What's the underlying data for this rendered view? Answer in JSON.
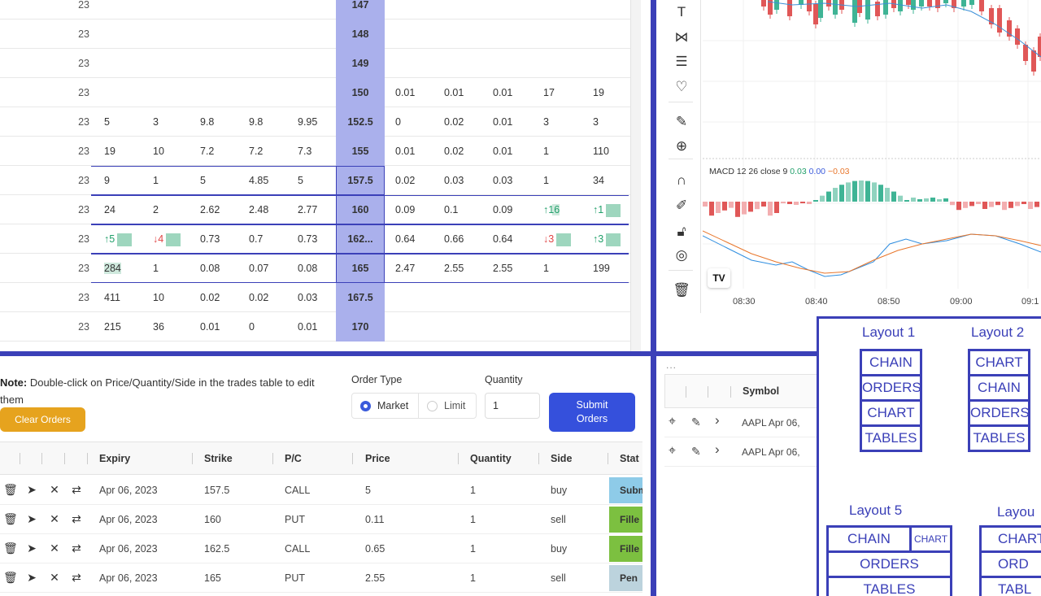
{
  "chain": {
    "rows": [
      {
        "exp": "23",
        "strike": "147",
        "cells": []
      },
      {
        "exp": "23",
        "strike": "148",
        "cells": []
      },
      {
        "exp": "23",
        "strike": "149",
        "cells": []
      },
      {
        "exp": "23",
        "strike": "150",
        "cells": [
          "",
          "",
          "",
          "",
          "",
          "0.01",
          "0.01",
          "0.01",
          "17",
          "19"
        ]
      },
      {
        "exp": "23",
        "strike": "152.5",
        "cells": [
          "5",
          "3",
          "9.8",
          "9.8",
          "9.95",
          "0",
          "0.02",
          "0.01",
          "3",
          "3"
        ]
      },
      {
        "exp": "23",
        "strike": "155",
        "cells": [
          "19",
          "10",
          "7.2",
          "7.2",
          "7.3",
          "0.01",
          "0.02",
          "0.01",
          "1",
          "110"
        ]
      },
      {
        "exp": "23",
        "strike": "157.5",
        "cells": [
          "9",
          "1",
          "5",
          "4.85",
          "5",
          "0.02",
          "0.03",
          "0.03",
          "1",
          "34"
        ]
      },
      {
        "exp": "23",
        "strike": "160",
        "cells": [
          "24",
          "2",
          "2.62",
          "2.48",
          "2.77",
          "0.09",
          "0.1",
          "0.09",
          "↑16",
          "↑1"
        ]
      },
      {
        "exp": "23",
        "strike": "162...",
        "cells": [
          "↑5",
          "↓4",
          "0.73",
          "0.7",
          "0.73",
          "0.64",
          "0.66",
          "0.64",
          "↓3",
          "↑3"
        ]
      },
      {
        "exp": "23",
        "strike": "165",
        "cells": [
          "284",
          "1",
          "0.08",
          "0.07",
          "0.08",
          "2.47",
          "2.55",
          "2.55",
          "1",
          "199"
        ]
      },
      {
        "exp": "23",
        "strike": "167.5",
        "cells": [
          "411",
          "10",
          "0.02",
          "0.02",
          "0.03",
          "",
          "",
          "",
          "",
          ""
        ]
      },
      {
        "exp": "23",
        "strike": "170",
        "cells": [
          "215",
          "36",
          "0.01",
          "0",
          "0.01",
          "",
          "",
          "",
          "",
          ""
        ]
      }
    ]
  },
  "chart": {
    "macd_label": "MACD 12 26 close 9",
    "macd_values": [
      "0.03",
      "0.00",
      "−0.03"
    ],
    "macd_colors": [
      "#22a06b",
      "#3b5bdb",
      "#e8762b"
    ],
    "x_ticks": [
      "08:30",
      "08:40",
      "08:50",
      "09:00",
      "09:1"
    ],
    "toolbar_icons": [
      "text-icon",
      "pattern-icon",
      "fib-icon",
      "heart-icon",
      "ruler-icon",
      "zoom-in-icon",
      "magnet-icon",
      "pencil-lock-icon",
      "lock-icon",
      "eye-icon",
      "trash-icon"
    ],
    "watermark": "TV"
  },
  "orders": {
    "note_bold": "Note:",
    "note_text": " Double-click on Price/Quantity/Side in the trades table to edit them",
    "clear_label": "Clear Orders",
    "order_type_label": "Order Type",
    "market_label": "Market",
    "limit_label": "Limit",
    "quantity_label": "Quantity",
    "quantity_value": "1",
    "submit_label": "Submit Orders",
    "columns": [
      "Expiry",
      "Strike",
      "P/C",
      "Price",
      "Quantity",
      "Side",
      "Stat"
    ],
    "rows": [
      {
        "expiry": "Apr 06, 2023",
        "strike": "157.5",
        "pc": "CALL",
        "price": "5",
        "qty": "1",
        "side": "buy",
        "status": "Subm",
        "status_color": "#8ecbe8"
      },
      {
        "expiry": "Apr 06, 2023",
        "strike": "160",
        "pc": "PUT",
        "price": "0.11",
        "qty": "1",
        "side": "sell",
        "status": "Fille",
        "status_color": "#7cc040"
      },
      {
        "expiry": "Apr 06, 2023",
        "strike": "162.5",
        "pc": "CALL",
        "price": "0.65",
        "qty": "1",
        "side": "buy",
        "status": "Fille",
        "status_color": "#7cc040"
      },
      {
        "expiry": "Apr 06, 2023",
        "strike": "165",
        "pc": "PUT",
        "price": "2.55",
        "qty": "1",
        "side": "sell",
        "status": "Pen",
        "status_color": "#bcd3dd"
      }
    ]
  },
  "symbols": {
    "more": "...",
    "header": "Symbol",
    "rows": [
      "AAPL Apr 06,",
      "AAPL Apr 06,"
    ]
  },
  "layouts": {
    "layout1": {
      "title": "Layout 1",
      "items": [
        "CHAIN",
        "ORDERS",
        "CHART",
        "TABLES"
      ]
    },
    "layout2": {
      "title": "Layout 2",
      "items": [
        "CHART",
        "CHAIN",
        "ORDERS",
        "TABLES"
      ]
    },
    "layout5": {
      "title": "Layout 5",
      "items": [
        "CHAIN",
        "CHART",
        "ORDERS",
        "TABLES"
      ]
    },
    "layout6": {
      "title": "Layou",
      "items": [
        "CHART",
        "ORD",
        "TABL"
      ]
    }
  }
}
